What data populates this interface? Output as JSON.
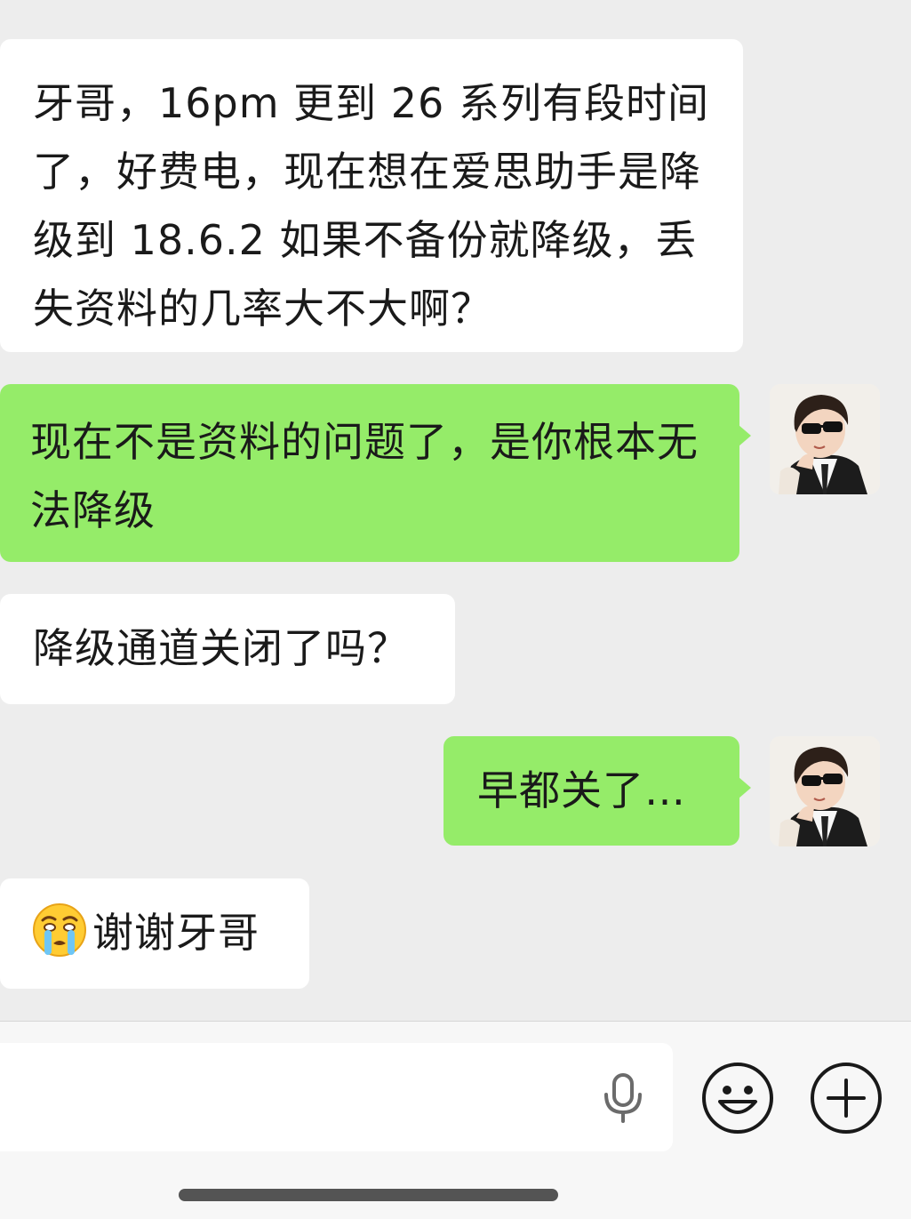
{
  "messages": [
    {
      "side": "received",
      "text": "牙哥，16pm 更到 26 系列有段时间了，好费电，现在想在爱思助手是降级到 18.6.2 如果不备份就降级，丢失资料的几率大不大啊？"
    },
    {
      "side": "sent",
      "text": "现在不是资料的问题了，是你根本无法降级"
    },
    {
      "side": "received",
      "text": "降级通道关闭了吗？"
    },
    {
      "side": "sent",
      "text": "早都关了…"
    },
    {
      "side": "received",
      "emoji": "crying-face",
      "text": "谢谢牙哥"
    }
  ],
  "input": {
    "value": "",
    "placeholder": ""
  },
  "icons": {
    "voice": "mic-icon",
    "emoji": "smiley-icon",
    "more": "plus-circle-icon"
  },
  "colors": {
    "chat_background": "#ededed",
    "sent_bubble": "#95ec69",
    "received_bubble": "#ffffff",
    "text": "#1a1a1a"
  }
}
